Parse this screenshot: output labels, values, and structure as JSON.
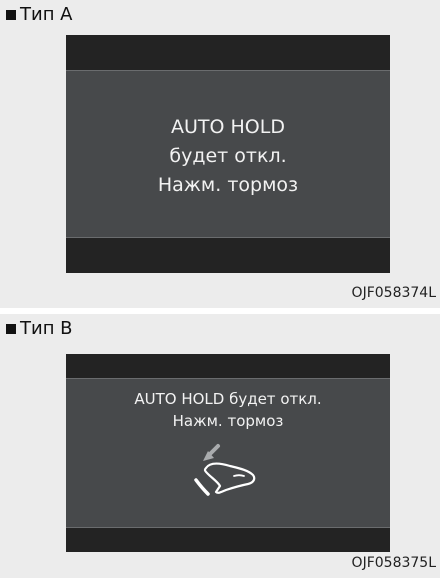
{
  "type_a": {
    "label": "Тип А",
    "display": {
      "line1": "AUTO HOLD",
      "line2": "будет откл.",
      "line3": "Нажм. тормоз"
    },
    "code": "OJF058374L"
  },
  "type_b": {
    "label": "Тип В",
    "display": {
      "line1": "AUTO HOLD будет откл.",
      "line2": "Нажм. тормоз",
      "icon": "foot-on-brake-pedal-icon"
    },
    "code": "OJF058375L"
  },
  "colors": {
    "screen": "#47494b",
    "bar": "#232323",
    "panel": "#ececec",
    "text": "#f2f2f2"
  }
}
